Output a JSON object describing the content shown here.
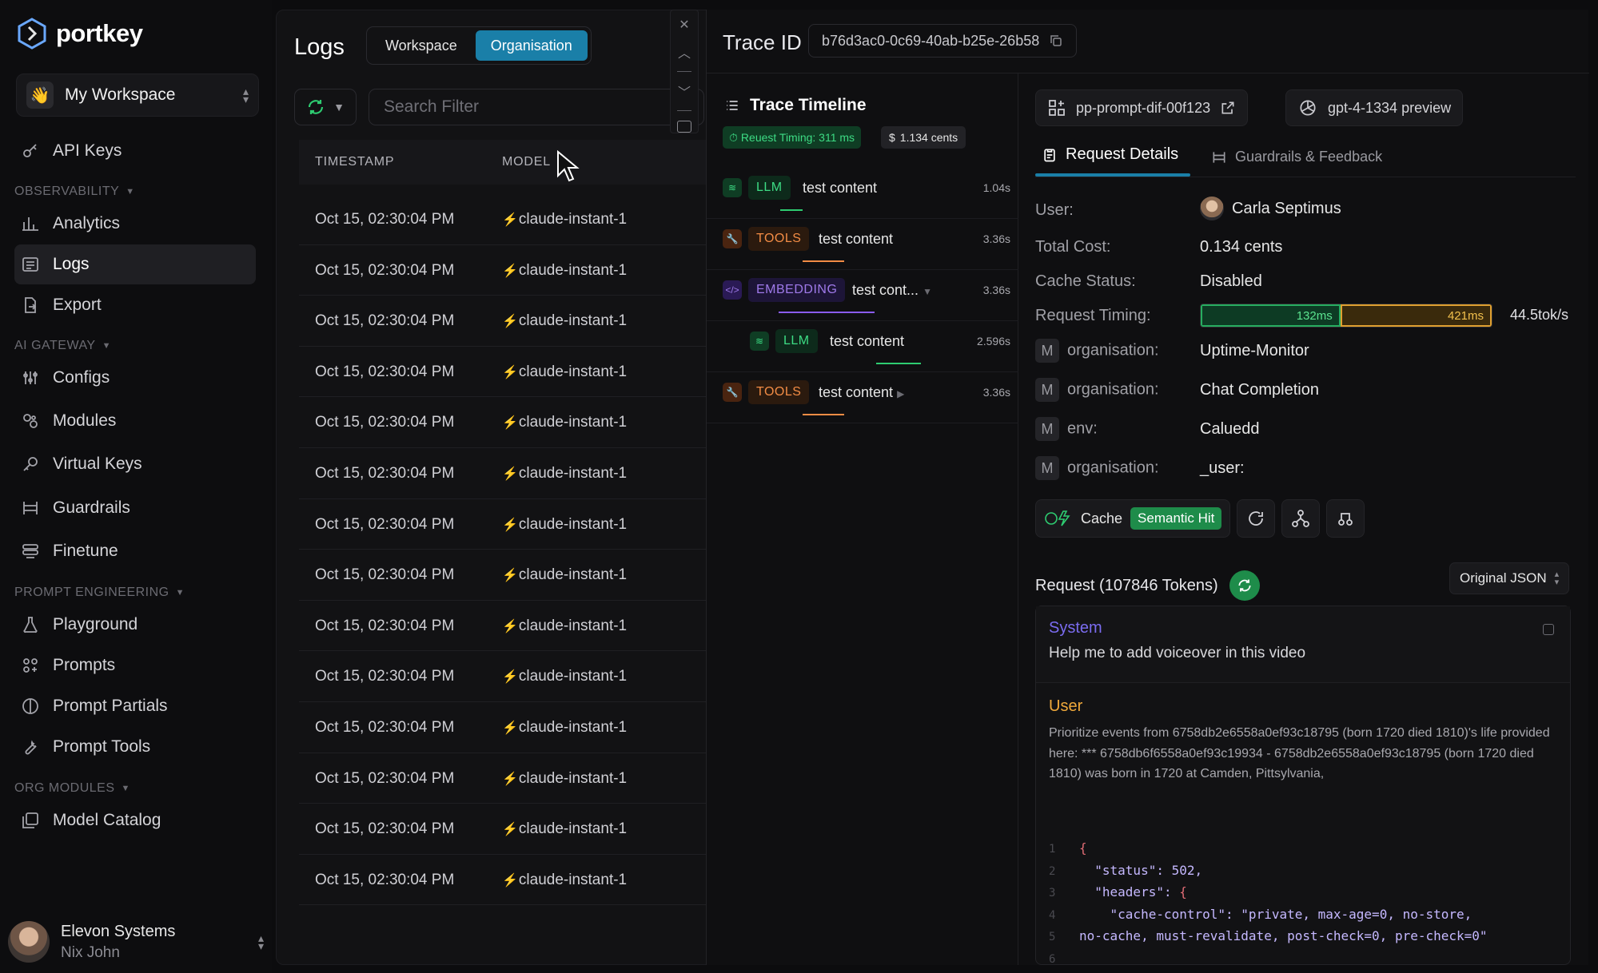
{
  "brand": {
    "name": "portkey"
  },
  "workspace": {
    "name": "My Workspace",
    "emoji": "👋"
  },
  "nav": {
    "api_keys": "API Keys",
    "observability": "OBSERVABILITY",
    "analytics": "Analytics",
    "logs": "Logs",
    "export": "Export",
    "ai_gateway": "AI GATEWAY",
    "configs": "Configs",
    "modules": "Modules",
    "virtual_keys": "Virtual Keys",
    "guardrails": "Guardrails",
    "finetune": "Finetune",
    "prompt_engineering": "PROMPT ENGINEERING",
    "playground": "Playground",
    "prompts": "Prompts",
    "prompt_partials": "Prompt Partials",
    "prompt_tools": "Prompt Tools",
    "org_modules": "ORG MODULES",
    "model_catalog": "Model Catalog"
  },
  "user": {
    "org": "Elevon Systems",
    "name": "Nix John"
  },
  "logs": {
    "title": "Logs",
    "scope_workspace": "Workspace",
    "scope_organisation": "Organisation",
    "search_placeholder": "Search Filter",
    "col_timestamp": "TIMESTAMP",
    "col_model": "MODEL",
    "rows": [
      {
        "ts": "Oct 15, 02:30:04 PM",
        "model": "claude-instant-1"
      },
      {
        "ts": "Oct 15, 02:30:04 PM",
        "model": "claude-instant-1"
      },
      {
        "ts": "Oct 15, 02:30:04 PM",
        "model": "claude-instant-1"
      },
      {
        "ts": "Oct 15, 02:30:04 PM",
        "model": "claude-instant-1"
      },
      {
        "ts": "Oct 15, 02:30:04 PM",
        "model": "claude-instant-1"
      },
      {
        "ts": "Oct 15, 02:30:04 PM",
        "model": "claude-instant-1"
      },
      {
        "ts": "Oct 15, 02:30:04 PM",
        "model": "claude-instant-1"
      },
      {
        "ts": "Oct 15, 02:30:04 PM",
        "model": "claude-instant-1"
      },
      {
        "ts": "Oct 15, 02:30:04 PM",
        "model": "claude-instant-1"
      },
      {
        "ts": "Oct 15, 02:30:04 PM",
        "model": "claude-instant-1"
      },
      {
        "ts": "Oct 15, 02:30:04 PM",
        "model": "claude-instant-1"
      },
      {
        "ts": "Oct 15, 02:30:04 PM",
        "model": "claude-instant-1"
      },
      {
        "ts": "Oct 15, 02:30:04 PM",
        "model": "claude-instant-1"
      },
      {
        "ts": "Oct 15, 02:30:04 PM",
        "model": "claude-instant-1"
      }
    ]
  },
  "trace": {
    "label": "Trace ID",
    "id": "b76d3ac0-0c69-40ab-b25e-26b58",
    "timeline_title": "Trace Timeline",
    "request_timing": "Reuest Timing: 311 ms",
    "cost": "1.134 cents",
    "spans": [
      {
        "tag": "LLM",
        "text": "test content",
        "dur": "1.04s"
      },
      {
        "tag": "TOOLS",
        "text": "test content",
        "dur": "3.36s"
      },
      {
        "tag": "EMBEDDING",
        "text": "test cont...",
        "dur": "3.36s"
      },
      {
        "tag": "LLM",
        "text": "test content",
        "dur": "2.596s"
      },
      {
        "tag": "TOOLS",
        "text": "test content",
        "dur": "3.36s"
      }
    ]
  },
  "details": {
    "prompt_chip": "pp-prompt-dif-00f123",
    "model_chip": "gpt-4-1334 preview",
    "tab_request": "Request Details",
    "tab_guardrails": "Guardrails & Feedback",
    "user_label": "User:",
    "user_value": "Carla Septimus",
    "cost_label": "Total Cost:",
    "cost_value": "0.134 cents",
    "cache_label": "Cache Status:",
    "cache_value": "Disabled",
    "timing_label": "Request Timing:",
    "timing_a": "132ms",
    "timing_b": "421ms",
    "timing_a_fraction": 0.48,
    "tok_rate": "44.5tok/s",
    "meta": [
      {
        "m": "M",
        "key": "organisation:",
        "value": "Uptime-Monitor"
      },
      {
        "m": "M",
        "key": "organisation:",
        "value": "Chat Completion"
      },
      {
        "m": "M",
        "key": "env:",
        "value": "Caluedd"
      },
      {
        "m": "M",
        "key": "organisation:",
        "value": "_user:"
      }
    ],
    "cache_pill": "Cache",
    "semantic_hit": "Semantic Hit",
    "request_title": "Request (107846 Tokens)",
    "json_mode": "Original JSON",
    "system_label": "System",
    "system_text": "Help me to add voiceover in this video",
    "user_msg_label": "User",
    "user_msg_text": "Prioritize events from 6758db2e6558a0ef93c18795 (born 1720 died 1810)'s life provided here: *** 6758db6f6558a0ef93c19934 - 6758db2e6558a0ef93c18795 (born 1720 died 1810) was born in 1720 at Camden, Pittsylvania,",
    "code": {
      "l1": "{",
      "l2_key": "\"status\"",
      "l2_val": "502,",
      "l3_key": "\"headers\"",
      "l3_val": "{",
      "l4_key": "\"cache-control\"",
      "l4_val": "\"private, max-age=0, no-store,",
      "l5": "no-cache, must-revalidate, post-check=0, pre-check=0\"",
      "n1": "1",
      "n2": "2",
      "n3": "3",
      "n4": "4",
      "n5": "5",
      "n6": "6"
    }
  },
  "colors": {
    "accent": "#1a7fa8",
    "green": "#1e8c4a",
    "orange": "#e0a030",
    "purple": "#7b6cf0"
  }
}
